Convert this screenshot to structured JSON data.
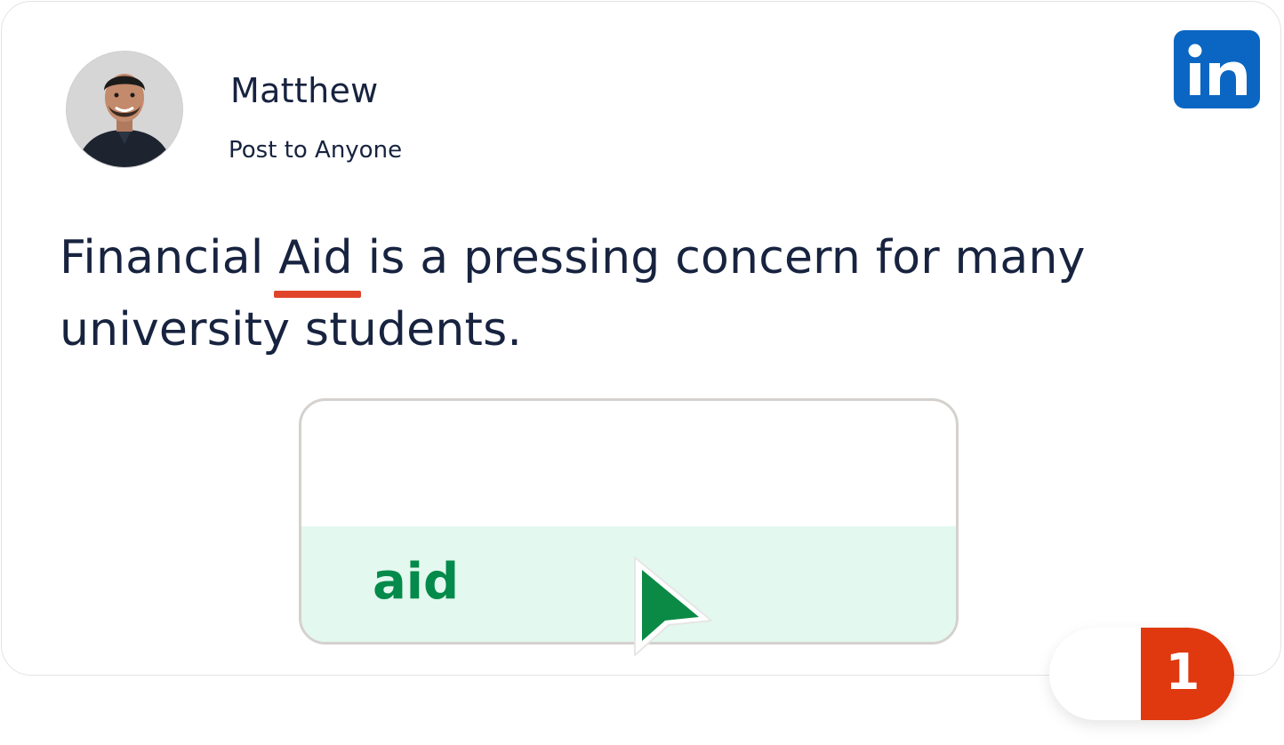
{
  "post": {
    "author_name": "Matthew",
    "visibility": "Post to Anyone",
    "text_before": "Financial ",
    "flagged_word": "Aid",
    "text_after": " is a pressing concern for many university students."
  },
  "suggestion": {
    "replacement": "aid"
  },
  "issue_counter": {
    "count": "1"
  },
  "brand": {
    "logo_text": "in",
    "logo_color": "#0a66c2"
  },
  "colors": {
    "underline": "#e0452b",
    "suggestion_text": "#048a4a",
    "suggestion_bg": "#e3f8ef",
    "counter_badge": "#e0380f",
    "body_text": "#17233f"
  }
}
